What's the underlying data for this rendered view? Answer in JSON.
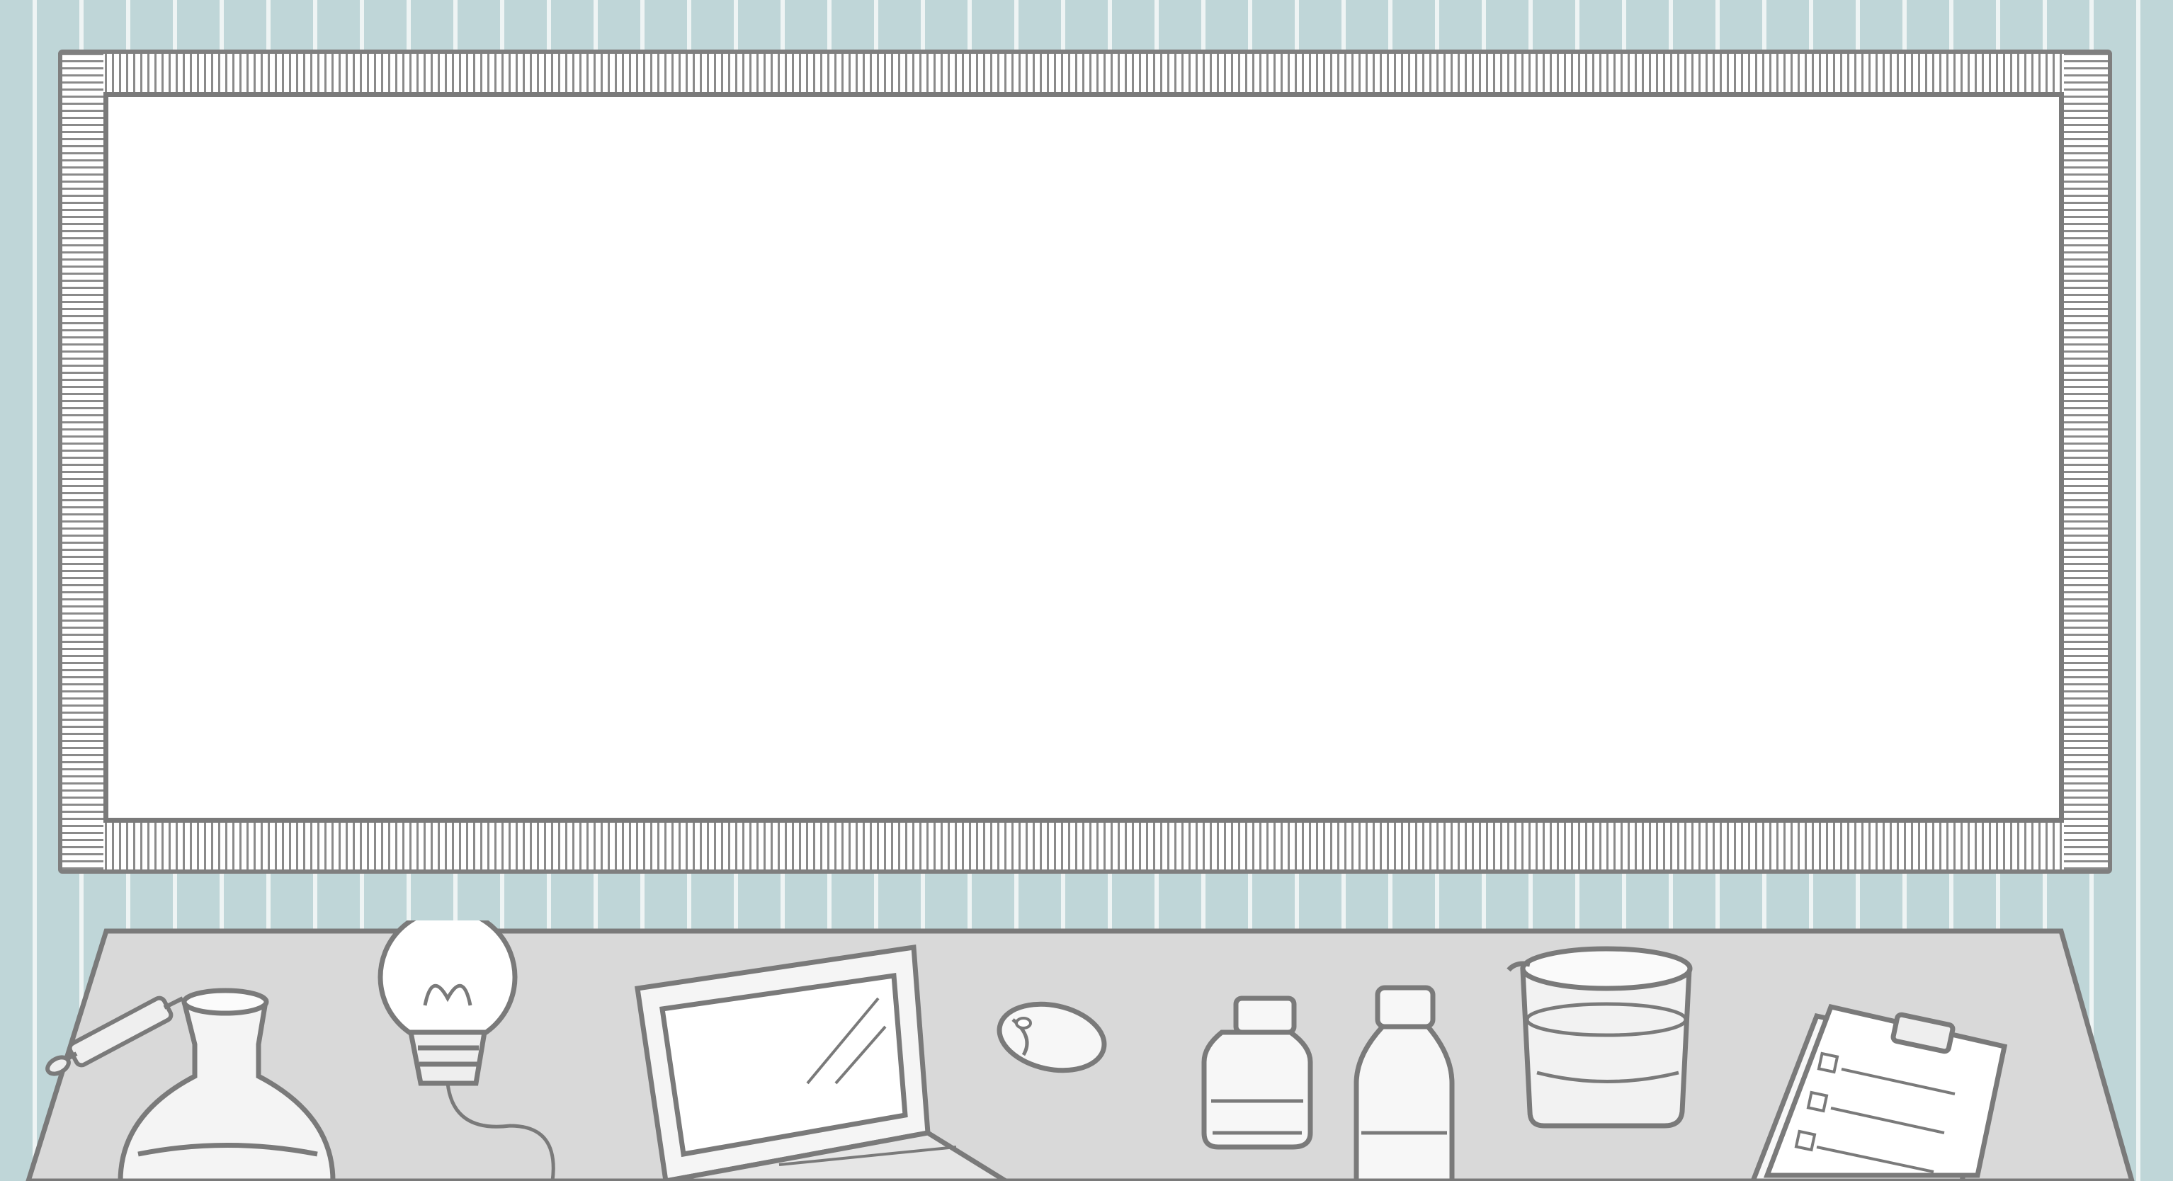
{
  "scene": {
    "wall_color": "#bfd6d8",
    "stripe_color": "#f0f6f6",
    "board_color": "#ffffff",
    "frame_color": "#7f7f7f",
    "desk_color": "#d9d9d9",
    "outline_color": "#7a7a7a"
  },
  "props": [
    "syringe-icon",
    "round-flask-icon",
    "light-bulb-icon",
    "laptop-icon",
    "computer-mouse-icon",
    "small-bottle-icon",
    "vial-icon",
    "beaker-icon",
    "clipboard-checklist-icon"
  ]
}
